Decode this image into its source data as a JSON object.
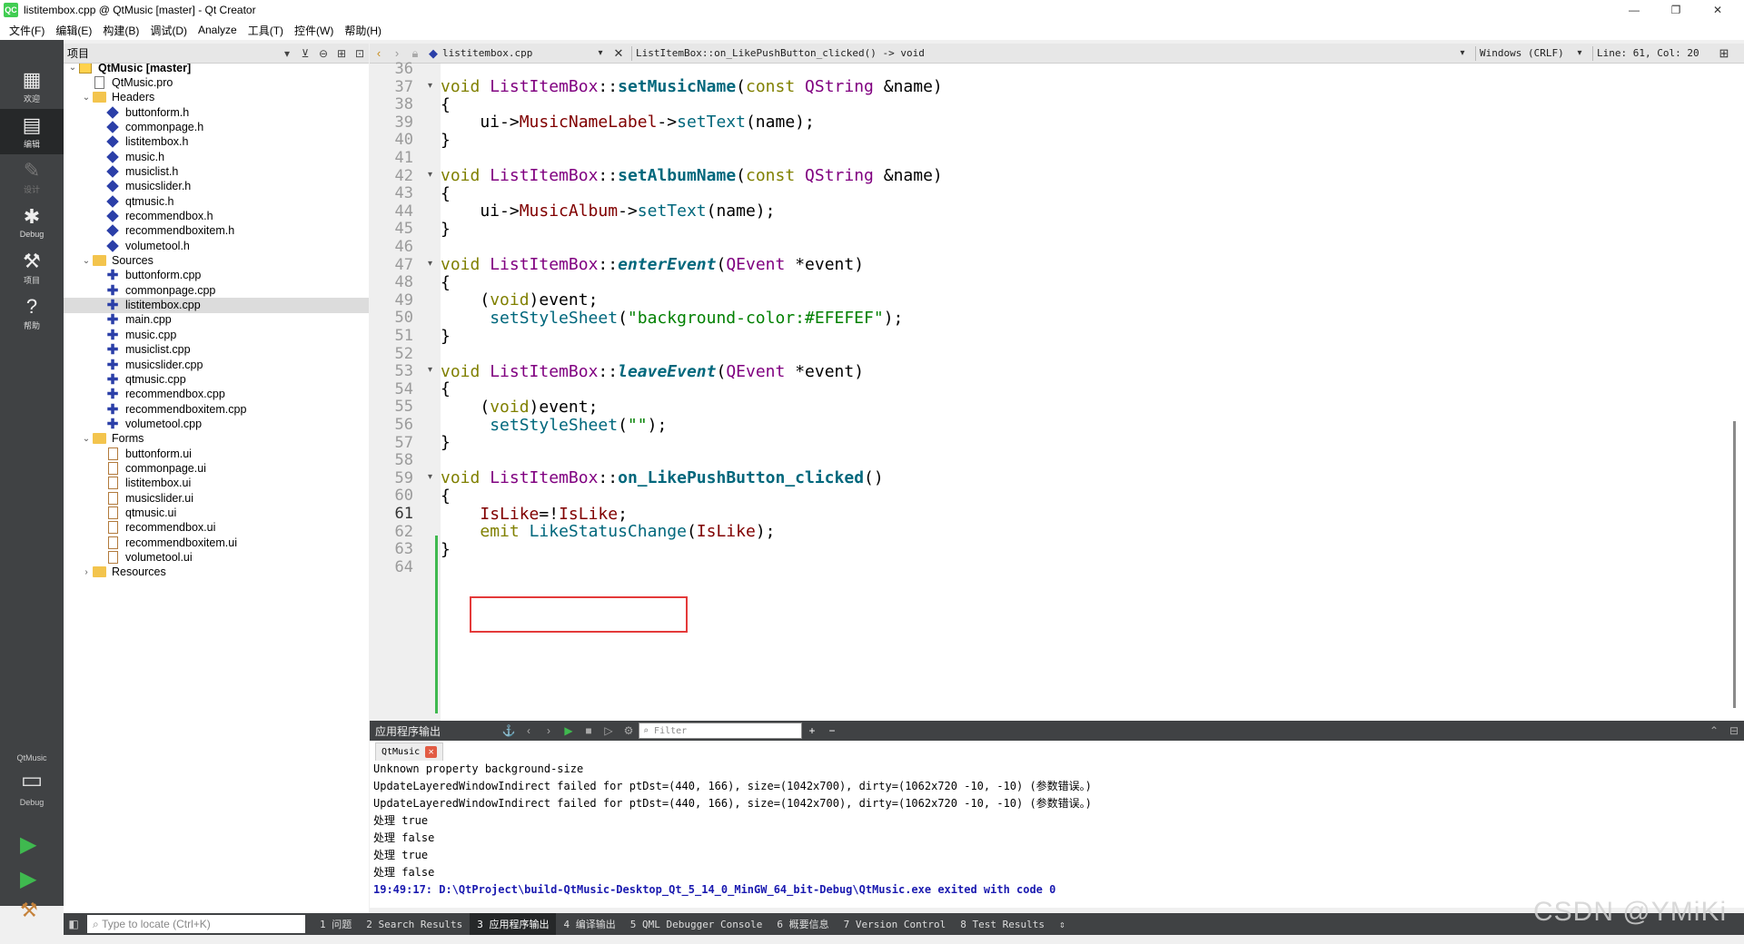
{
  "window": {
    "title": "listitembox.cpp @ QtMusic [master] - Qt Creator",
    "app_icon_text": "QC",
    "controls": [
      "—",
      "❐",
      "✕"
    ]
  },
  "menu": [
    "文件(F)",
    "编辑(E)",
    "构建(B)",
    "调试(D)",
    "Analyze",
    "工具(T)",
    "控件(W)",
    "帮助(H)"
  ],
  "modes": [
    {
      "label": "欢迎",
      "icon": "grid-icon"
    },
    {
      "label": "编辑",
      "icon": "edit-icon",
      "active": true
    },
    {
      "label": "设计",
      "icon": "pencil-icon",
      "disabled": true
    },
    {
      "label": "Debug",
      "icon": "bug-icon"
    },
    {
      "label": "项目",
      "icon": "wrench-icon"
    },
    {
      "label": "帮助",
      "icon": "help-icon"
    }
  ],
  "kit": {
    "project": "QtMusic",
    "config": "Debug"
  },
  "project_pane": {
    "title": "项目",
    "tree": [
      {
        "label": "QtMusic [master]",
        "type": "project",
        "depth": 0,
        "expanded": true,
        "bold": true
      },
      {
        "label": "QtMusic.pro",
        "type": "pro",
        "depth": 1
      },
      {
        "label": "Headers",
        "type": "folder",
        "depth": 1,
        "expanded": true
      },
      {
        "label": "buttonform.h",
        "type": "h",
        "depth": 2
      },
      {
        "label": "commonpage.h",
        "type": "h",
        "depth": 2
      },
      {
        "label": "listitembox.h",
        "type": "h",
        "depth": 2
      },
      {
        "label": "music.h",
        "type": "h",
        "depth": 2
      },
      {
        "label": "musiclist.h",
        "type": "h",
        "depth": 2
      },
      {
        "label": "musicslider.h",
        "type": "h",
        "depth": 2
      },
      {
        "label": "qtmusic.h",
        "type": "h",
        "depth": 2
      },
      {
        "label": "recommendbox.h",
        "type": "h",
        "depth": 2
      },
      {
        "label": "recommendboxitem.h",
        "type": "h",
        "depth": 2
      },
      {
        "label": "volumetool.h",
        "type": "h",
        "depth": 2
      },
      {
        "label": "Sources",
        "type": "folder",
        "depth": 1,
        "expanded": true
      },
      {
        "label": "buttonform.cpp",
        "type": "cpp",
        "depth": 2
      },
      {
        "label": "commonpage.cpp",
        "type": "cpp",
        "depth": 2
      },
      {
        "label": "listitembox.cpp",
        "type": "cpp",
        "depth": 2,
        "selected": true
      },
      {
        "label": "main.cpp",
        "type": "cpp",
        "depth": 2
      },
      {
        "label": "music.cpp",
        "type": "cpp",
        "depth": 2
      },
      {
        "label": "musiclist.cpp",
        "type": "cpp",
        "depth": 2
      },
      {
        "label": "musicslider.cpp",
        "type": "cpp",
        "depth": 2
      },
      {
        "label": "qtmusic.cpp",
        "type": "cpp",
        "depth": 2
      },
      {
        "label": "recommendbox.cpp",
        "type": "cpp",
        "depth": 2
      },
      {
        "label": "recommendboxitem.cpp",
        "type": "cpp",
        "depth": 2
      },
      {
        "label": "volumetool.cpp",
        "type": "cpp",
        "depth": 2
      },
      {
        "label": "Forms",
        "type": "folder",
        "depth": 1,
        "expanded": true
      },
      {
        "label": "buttonform.ui",
        "type": "ui",
        "depth": 2
      },
      {
        "label": "commonpage.ui",
        "type": "ui",
        "depth": 2
      },
      {
        "label": "listitembox.ui",
        "type": "ui",
        "depth": 2
      },
      {
        "label": "musicslider.ui",
        "type": "ui",
        "depth": 2
      },
      {
        "label": "qtmusic.ui",
        "type": "ui",
        "depth": 2
      },
      {
        "label": "recommendbox.ui",
        "type": "ui",
        "depth": 2
      },
      {
        "label": "recommendboxitem.ui",
        "type": "ui",
        "depth": 2
      },
      {
        "label": "volumetool.ui",
        "type": "ui",
        "depth": 2
      },
      {
        "label": "Resources",
        "type": "folder",
        "depth": 1,
        "expanded": false
      }
    ]
  },
  "editor_toolbar": {
    "file": "listitembox.cpp",
    "symbol": "ListItemBox::on_LikePushButton_clicked() -> void",
    "line_ending": "Windows (CRLF)",
    "position": "Line: 61, Col: 20"
  },
  "code": {
    "current_line": 61,
    "fold_lines": [
      37,
      42,
      47,
      53,
      59
    ],
    "lines": [
      {
        "n": 36,
        "tokens": []
      },
      {
        "n": 37,
        "tokens": [
          [
            "kw",
            "void"
          ],
          [
            "op",
            " "
          ],
          [
            "ty",
            "ListItemBox"
          ],
          [
            "op",
            "::"
          ],
          [
            "fnb",
            "setMusicName"
          ],
          [
            "op",
            "("
          ],
          [
            "kw",
            "const"
          ],
          [
            "op",
            " "
          ],
          [
            "ty",
            "QString"
          ],
          [
            "op",
            " &name)"
          ]
        ]
      },
      {
        "n": 38,
        "tokens": [
          [
            "op",
            "{"
          ]
        ]
      },
      {
        "n": 39,
        "tokens": [
          [
            "op",
            "    ui->"
          ],
          [
            "mem",
            "MusicNameLabel"
          ],
          [
            "op",
            "->"
          ],
          [
            "fn",
            "setText"
          ],
          [
            "op",
            "(name);"
          ]
        ]
      },
      {
        "n": 40,
        "tokens": [
          [
            "op",
            "}"
          ]
        ]
      },
      {
        "n": 41,
        "tokens": []
      },
      {
        "n": 42,
        "tokens": [
          [
            "kw",
            "void"
          ],
          [
            "op",
            " "
          ],
          [
            "ty",
            "ListItemBox"
          ],
          [
            "op",
            "::"
          ],
          [
            "fnb",
            "setAlbumName"
          ],
          [
            "op",
            "("
          ],
          [
            "kw",
            "const"
          ],
          [
            "op",
            " "
          ],
          [
            "ty",
            "QString"
          ],
          [
            "op",
            " &name)"
          ]
        ]
      },
      {
        "n": 43,
        "tokens": [
          [
            "op",
            "{"
          ]
        ]
      },
      {
        "n": 44,
        "tokens": [
          [
            "op",
            "    ui->"
          ],
          [
            "mem",
            "MusicAlbum"
          ],
          [
            "op",
            "->"
          ],
          [
            "fn",
            "setText"
          ],
          [
            "op",
            "(name);"
          ]
        ]
      },
      {
        "n": 45,
        "tokens": [
          [
            "op",
            "}"
          ]
        ]
      },
      {
        "n": 46,
        "tokens": []
      },
      {
        "n": 47,
        "tokens": [
          [
            "kw",
            "void"
          ],
          [
            "op",
            " "
          ],
          [
            "ty",
            "ListItemBox"
          ],
          [
            "op",
            "::"
          ],
          [
            "fni",
            "enterEvent"
          ],
          [
            "op",
            "("
          ],
          [
            "ty",
            "QEvent"
          ],
          [
            "op",
            " *event)"
          ]
        ]
      },
      {
        "n": 48,
        "tokens": [
          [
            "op",
            "{"
          ]
        ]
      },
      {
        "n": 49,
        "tokens": [
          [
            "op",
            "    ("
          ],
          [
            "kw",
            "void"
          ],
          [
            "op",
            ")event;"
          ]
        ]
      },
      {
        "n": 50,
        "tokens": [
          [
            "op",
            "     "
          ],
          [
            "fn",
            "setStyleSheet"
          ],
          [
            "op",
            "("
          ],
          [
            "st",
            "\"background-color:#EFEFEF\""
          ],
          [
            "op",
            ");"
          ]
        ]
      },
      {
        "n": 51,
        "tokens": [
          [
            "op",
            "}"
          ]
        ]
      },
      {
        "n": 52,
        "tokens": []
      },
      {
        "n": 53,
        "tokens": [
          [
            "kw",
            "void"
          ],
          [
            "op",
            " "
          ],
          [
            "ty",
            "ListItemBox"
          ],
          [
            "op",
            "::"
          ],
          [
            "fni",
            "leaveEvent"
          ],
          [
            "op",
            "("
          ],
          [
            "ty",
            "QEvent"
          ],
          [
            "op",
            " *event)"
          ]
        ]
      },
      {
        "n": 54,
        "tokens": [
          [
            "op",
            "{"
          ]
        ]
      },
      {
        "n": 55,
        "tokens": [
          [
            "op",
            "    ("
          ],
          [
            "kw",
            "void"
          ],
          [
            "op",
            ")event;"
          ]
        ]
      },
      {
        "n": 56,
        "tokens": [
          [
            "op",
            "     "
          ],
          [
            "fn",
            "setStyleSheet"
          ],
          [
            "op",
            "("
          ],
          [
            "st",
            "\"\""
          ],
          [
            "op",
            ");"
          ]
        ]
      },
      {
        "n": 57,
        "tokens": [
          [
            "op",
            "}"
          ]
        ]
      },
      {
        "n": 58,
        "tokens": []
      },
      {
        "n": 59,
        "tokens": [
          [
            "kw",
            "void"
          ],
          [
            "op",
            " "
          ],
          [
            "ty",
            "ListItemBox"
          ],
          [
            "op",
            "::"
          ],
          [
            "fnb",
            "on_LikePushButton_clicked"
          ],
          [
            "op",
            "()"
          ]
        ]
      },
      {
        "n": 60,
        "tokens": [
          [
            "op",
            "{"
          ]
        ]
      },
      {
        "n": 61,
        "tokens": [
          [
            "op",
            "    "
          ],
          [
            "mem",
            "IsLike"
          ],
          [
            "op",
            "=!"
          ],
          [
            "mem",
            "IsLike"
          ],
          [
            "op",
            ";"
          ]
        ]
      },
      {
        "n": 62,
        "tokens": [
          [
            "op",
            "    "
          ],
          [
            "kw",
            "emit"
          ],
          [
            "op",
            " "
          ],
          [
            "fn",
            "LikeStatusChange"
          ],
          [
            "op",
            "("
          ],
          [
            "mem",
            "IsLike"
          ],
          [
            "op",
            ");"
          ]
        ]
      },
      {
        "n": 63,
        "tokens": [
          [
            "op",
            "}"
          ]
        ]
      },
      {
        "n": 64,
        "tokens": []
      }
    ]
  },
  "output": {
    "title": "应用程序输出",
    "filter_placeholder": "Filter",
    "tab": "QtMusic",
    "lines": [
      {
        "text": "Unknown property background-size"
      },
      {
        "text": "UpdateLayeredWindowIndirect failed for ptDst=(440, 166), size=(1042x700), dirty=(1062x720 -10, -10) (参数错误。)"
      },
      {
        "text": "UpdateLayeredWindowIndirect failed for ptDst=(440, 166), size=(1042x700), dirty=(1062x720 -10, -10) (参数错误。)"
      },
      {
        "text": "处理 true"
      },
      {
        "text": "处理 false"
      },
      {
        "text": "处理 true"
      },
      {
        "text": "处理 false"
      },
      {
        "text": "19:49:17: D:\\QtProject\\build-QtMusic-Desktop_Qt_5_14_0_MinGW_64_bit-Debug\\QtMusic.exe exited with code 0",
        "exit": true
      }
    ]
  },
  "statusbar": {
    "locate_placeholder": "Type to locate (Ctrl+K)",
    "tabs": [
      "1 问题",
      "2 Search Results",
      "3 应用程序输出",
      "4 编译输出",
      "5 QML Debugger Console",
      "6 概要信息",
      "7 Version Control",
      "8 Test Results"
    ],
    "active_tab": 2
  },
  "watermark": "CSDN @YMiKi"
}
